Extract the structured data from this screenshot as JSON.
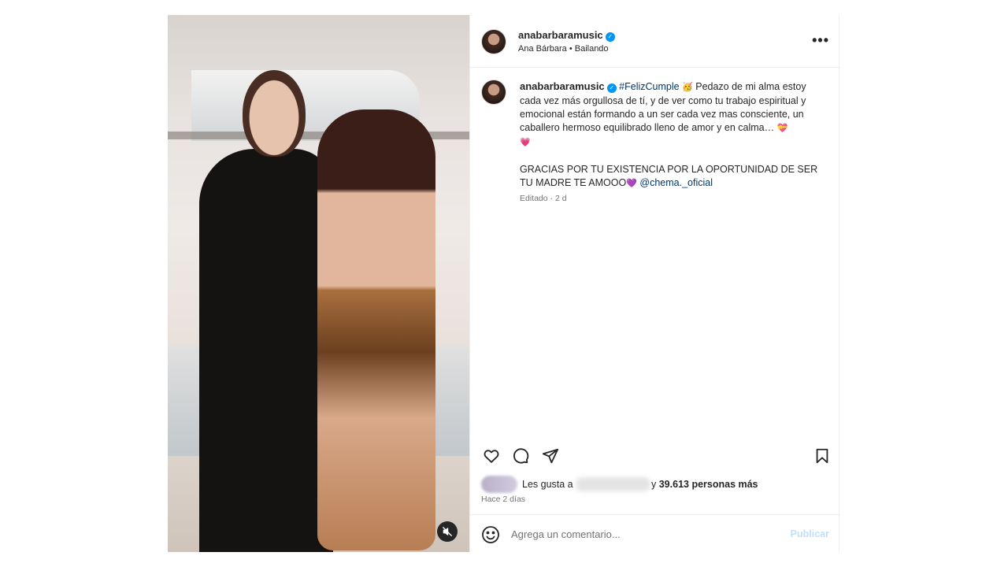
{
  "post": {
    "author": {
      "username": "anabarbaramusic",
      "verified": true,
      "subtitle_name": "Ana Bárbara",
      "subtitle_sep": " • ",
      "subtitle_audio": "Bailando"
    },
    "caption": {
      "username": "anabarbaramusic",
      "hashtag": "#FelizCumple",
      "emoji_1": "🥳",
      "text_1": " Pedazo de mi alma estoy cada vez más orgullosa de tí, y de ver como tu trabajo espiritual y emocional están formando a un ser cada vez mas consciente, un caballero hermoso equilibrado lleno de amor y en calma… ",
      "emoji_2": "💝",
      "emoji_3": "💗",
      "text_2": "GRACIAS POR TU EXISTENCIA POR LA OPORTUNIDAD DE SER TU MADRE TE AMOOO",
      "emoji_4": "💜",
      "mention": "@chema._oficial",
      "edited_label": "Editado · 2 d"
    },
    "likes": {
      "prefix": "Les gusta a",
      "suffix": "y",
      "count": "39.613 personas más"
    },
    "timestamp": "Hace 2 días",
    "comment": {
      "placeholder": "Agrega un comentario...",
      "publish_label": "Publicar"
    },
    "icons": {
      "more": "more-options-icon",
      "like": "heart-icon",
      "comment": "comment-bubble-icon",
      "share": "send-paper-plane-icon",
      "save": "bookmark-icon",
      "emoji": "smiley-face-icon",
      "mute": "speaker-muted-icon"
    },
    "colors": {
      "link": "#00376b",
      "verified": "#0095f6",
      "publish_disabled": "#c0dffd",
      "muted_text": "#737373"
    }
  }
}
